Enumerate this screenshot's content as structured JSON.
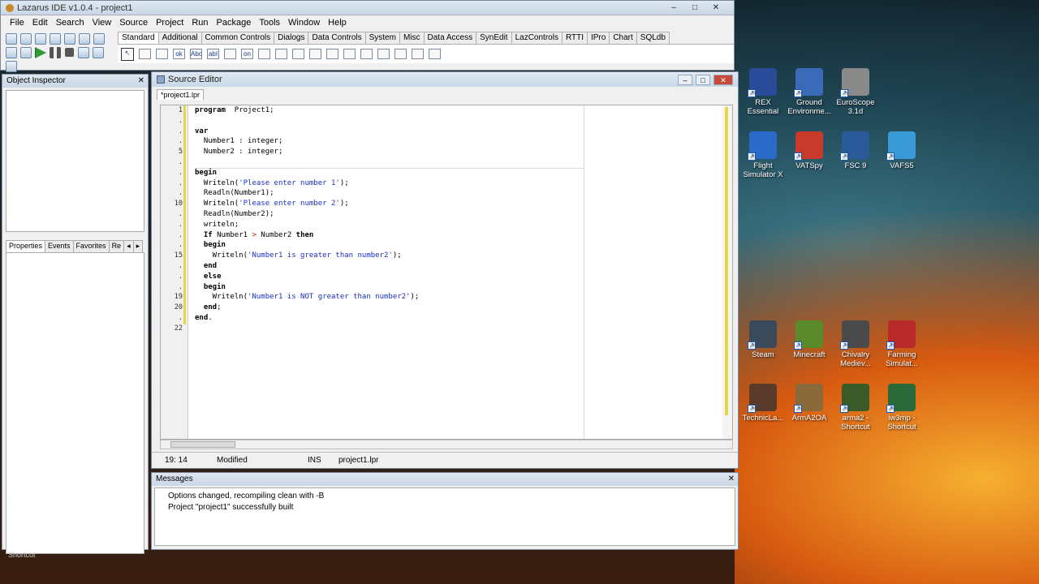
{
  "window": {
    "title": "Lazarus IDE v1.0.4 - project1",
    "controls": [
      "–",
      "□",
      "✕"
    ]
  },
  "menu": [
    "File",
    "Edit",
    "Search",
    "View",
    "Source",
    "Project",
    "Run",
    "Package",
    "Tools",
    "Window",
    "Help"
  ],
  "palette": {
    "tabs": [
      "Standard",
      "Additional",
      "Common Controls",
      "Dialogs",
      "Data Controls",
      "System",
      "Misc",
      "Data Access",
      "SynEdit",
      "LazControls",
      "RTTI",
      "IPro",
      "Chart",
      "SQLdb"
    ],
    "components": [
      "Abc",
      "abI",
      "ok",
      "on"
    ]
  },
  "object_inspector": {
    "title": "Object Inspector",
    "tabs": [
      "Properties",
      "Events",
      "Favorites",
      "Re"
    ]
  },
  "source_editor": {
    "title": "Source Editor",
    "file_tab": "*project1.lpr",
    "gutter": [
      "1",
      ".",
      ".",
      ".",
      "5",
      ".",
      ".",
      ".",
      ".",
      "10",
      ".",
      ".",
      ".",
      ".",
      "15",
      ".",
      ".",
      ".",
      "19",
      "20",
      ".",
      "22"
    ],
    "status": {
      "position": "19: 14",
      "modified": "Modified",
      "mode": "INS",
      "file": "project1.lpr"
    }
  },
  "messages": {
    "title": "Messages",
    "lines": [
      "Options changed, recompiling clean with -B",
      "Project \"project1\" successfully built"
    ]
  },
  "desktop_icons": [
    {
      "label": "REX Essential",
      "color": "#2a4a9a"
    },
    {
      "label": "Ground Environme...",
      "color": "#3a6ab8"
    },
    {
      "label": "EuroScope 3.1d",
      "color": "#8a8a8a"
    },
    {
      "label": "Flight Simulator X",
      "color": "#2a6ac8"
    },
    {
      "label": "VATSpy",
      "color": "#c83a2a"
    },
    {
      "label": "FSC 9",
      "color": "#2a5a9a"
    },
    {
      "label": "VAFS5",
      "color": "#3a9ad8"
    },
    {
      "label": "Steam",
      "color": "#3a4a5a"
    },
    {
      "label": "Minecraft",
      "color": "#5a8a2a"
    },
    {
      "label": "Chivalry Mediev...",
      "color": "#4a4a4a"
    },
    {
      "label": "Farming Simulat...",
      "color": "#b82a2a"
    },
    {
      "label": "TechnicLa...",
      "color": "#5a3a2a"
    },
    {
      "label": "ArmA2OA",
      "color": "#8a6a3a"
    },
    {
      "label": "arma2 - Shortcut",
      "color": "#3a5a2a"
    },
    {
      "label": "iw3mp - Shortcut",
      "color": "#2a6a3a"
    }
  ],
  "taskbar_hint": "Shortcut"
}
